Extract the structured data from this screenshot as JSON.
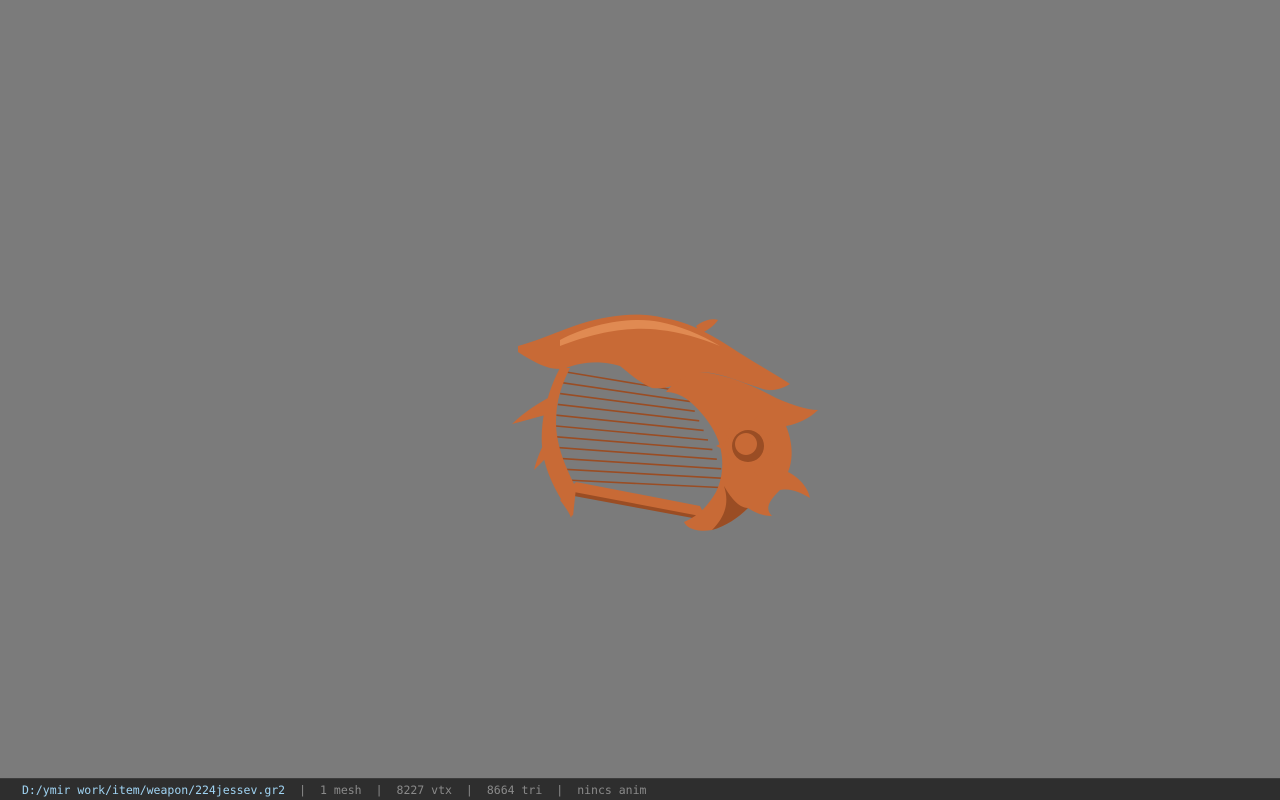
{
  "viewport": {
    "background_color": "#7b7b7b",
    "model": {
      "name": "harp-weapon-model",
      "color": "#c86a36",
      "shade_color": "#9a4d24",
      "highlight_color": "#e08a52",
      "string_count": 11
    }
  },
  "status_bar": {
    "file_path": "D:/ymir work/item/weapon/224jessev.gr2",
    "mesh_count": "1 mesh",
    "vertex_count": "8227 vtx",
    "triangle_count": "8664 tri",
    "animation": "nincs anim",
    "separator": "|",
    "path_color": "#9fd3f2",
    "text_color": "#8a8a8a"
  }
}
